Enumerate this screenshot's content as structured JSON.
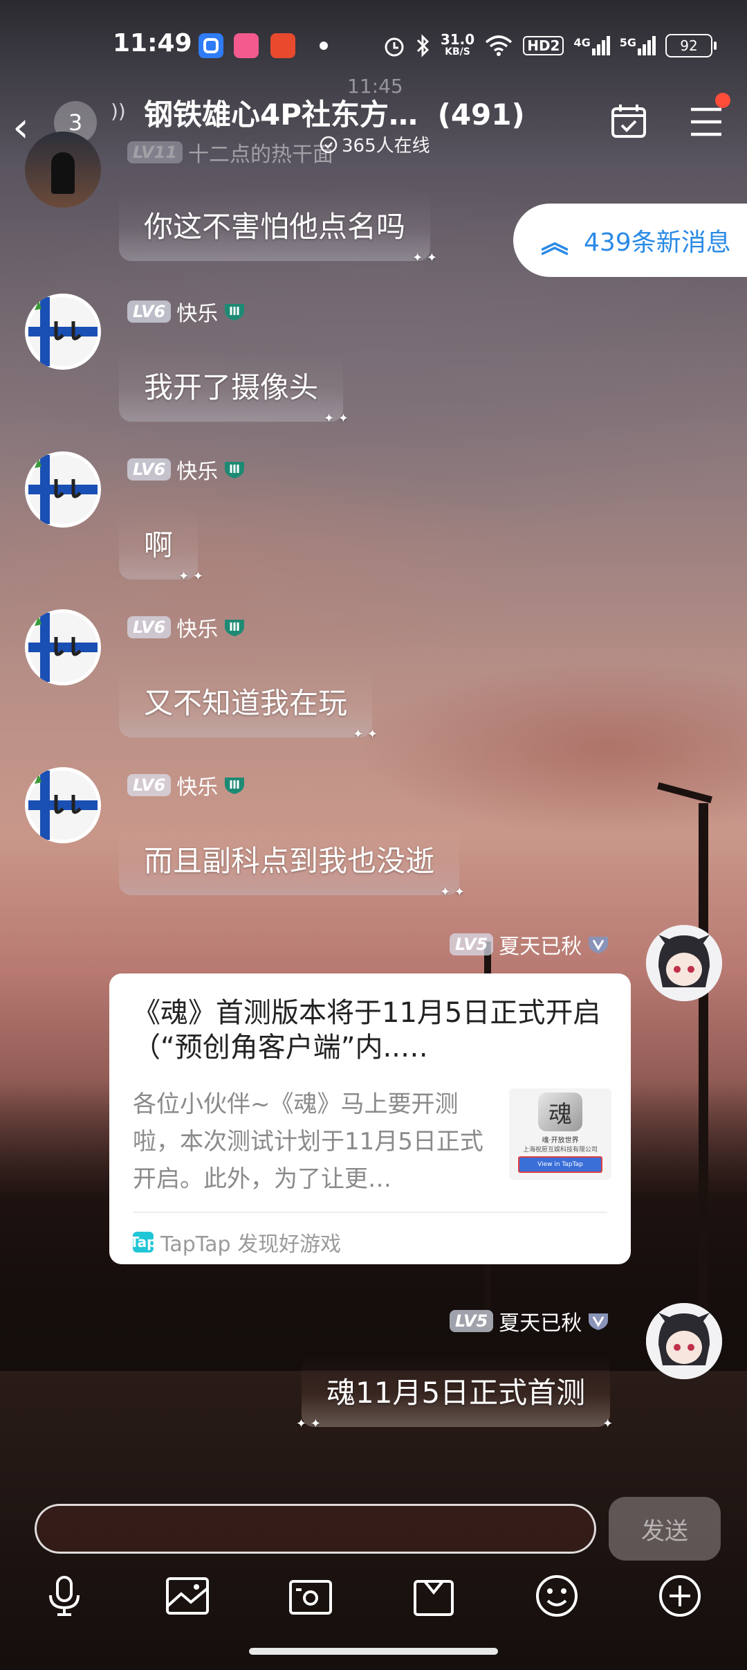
{
  "status_bar": {
    "time": "11:49",
    "net_speed_value": "31.0",
    "net_speed_unit": "KB/S",
    "hd_label": "HD2",
    "sig1_label": "4G",
    "sig2_label": "5G",
    "battery": "92",
    "icons": [
      "app-blue-icon",
      "bilibili-icon",
      "taobao-icon",
      "alarm-icon",
      "bluetooth-icon",
      "wifi-icon",
      "signal-icon",
      "signal-icon"
    ]
  },
  "header": {
    "back_icon": "chevron-left-icon",
    "unread_count": "3",
    "title": "钢铁雄心4P社东方…",
    "member_count": "(491)",
    "online_text": "365人在线",
    "ghost_time": "11:45"
  },
  "new_messages_label": "439条新消息",
  "messages": [
    {
      "level": "LV11",
      "name": "十二点的热干面",
      "text": "你这不害怕他点名吗"
    },
    {
      "level": "LV6",
      "name": "快乐",
      "text": "我开了摄像头"
    },
    {
      "level": "LV6",
      "name": "快乐",
      "text": "啊"
    },
    {
      "level": "LV6",
      "name": "快乐",
      "text": "又不知道我在玩"
    },
    {
      "level": "LV6",
      "name": "快乐",
      "text": "而且副科点到我也没逝"
    },
    {
      "level": "LV5",
      "name": "夏天已秋"
    },
    {
      "level": "LV5",
      "name": "夏天已秋",
      "text": "魂11月5日正式首测"
    }
  ],
  "card": {
    "title": "《魂》首测版本将于11月5日正式开启（“预创角客户端”内..…",
    "description": "各位小伙伴~《魂》马上要开测啦，本次测试计划于11月5日正式开启。此外，为了让更…",
    "thumb_text": "魂",
    "thumb_caption": "魂·开放世界",
    "thumb_company": "上海祝愿互娱科技有限公司",
    "thumb_button": "View in TapTap",
    "source_logo": "Tap",
    "source": "TapTap 发现好游戏"
  },
  "input": {
    "placeholder": "",
    "send_label": "发送"
  },
  "toolbar": [
    "microphone-icon",
    "image-icon",
    "camera-icon",
    "gift-icon",
    "emoji-icon",
    "plus-icon"
  ],
  "colors": {
    "accent_blue": "#2a8ae6",
    "badge_red": "#ff4d3a",
    "taptap": "#21c6d6"
  }
}
